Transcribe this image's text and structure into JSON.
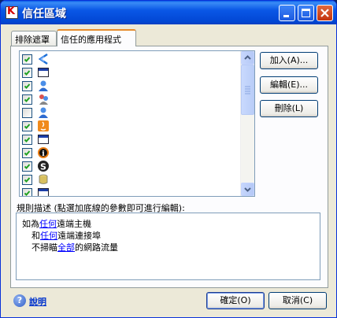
{
  "window": {
    "title": "信任區域"
  },
  "tabs": [
    {
      "label": "排除遮罩",
      "active": false
    },
    {
      "label": "信任的應用程式",
      "active": true
    }
  ],
  "app_list": [
    {
      "checked": true,
      "icon": "blue-arrow-icon"
    },
    {
      "checked": true,
      "icon": "window-app-icon"
    },
    {
      "checked": true,
      "icon": "user-icon"
    },
    {
      "checked": true,
      "icon": "user-group-icon"
    },
    {
      "checked": false,
      "icon": "user-icon"
    },
    {
      "checked": true,
      "icon": "java-icon"
    },
    {
      "checked": true,
      "icon": "window-app-icon"
    },
    {
      "checked": true,
      "icon": "info-icon"
    },
    {
      "checked": true,
      "icon": "s-logo-icon"
    },
    {
      "checked": true,
      "icon": "database-icon"
    },
    {
      "checked": true,
      "icon": "window-app-icon"
    }
  ],
  "buttons": {
    "add": "加入(A)...",
    "edit": "編輯(E)...",
    "delete": "刪除(L)"
  },
  "rule": {
    "label": "規則描述 (點選加底線的參數即可進行編輯):",
    "line1_pre": "如為",
    "line1_link": "任何",
    "line1_post": "遠端主機",
    "line2_pre": "和",
    "line2_link": "任何",
    "line2_post": "遠端連接埠",
    "line3_pre": "不掃瞄",
    "line3_link": "全部",
    "line3_post": "的網路流量"
  },
  "footer": {
    "help": "說明",
    "ok": "確定(O)",
    "cancel": "取消(C)"
  },
  "colors": {
    "titlebar": "#0a57e6",
    "link": "#0000ff",
    "dialog_bg": "#ece9d8"
  }
}
